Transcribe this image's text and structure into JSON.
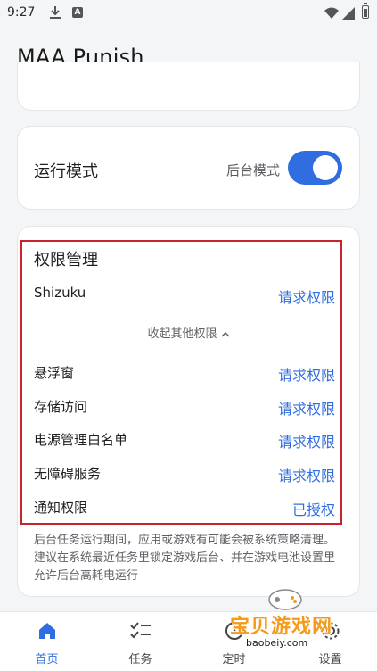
{
  "status": {
    "time": "9:27",
    "a_badge": "A"
  },
  "app": {
    "title": "MAA Punish"
  },
  "mode": {
    "label": "运行模式",
    "value": "后台模式",
    "toggle_on": true
  },
  "permissions": {
    "title": "权限管理",
    "shizuku": {
      "label": "Shizuku",
      "action": "请求权限"
    },
    "collapse_label": "收起其他权限",
    "rows": [
      {
        "label": "悬浮窗",
        "action": "请求权限"
      },
      {
        "label": "存储访问",
        "action": "请求权限"
      },
      {
        "label": "电源管理白名单",
        "action": "请求权限"
      },
      {
        "label": "无障碍服务",
        "action": "请求权限"
      },
      {
        "label": "通知权限",
        "action": "已授权"
      }
    ],
    "note": "后台任务运行期间，应用或游戏有可能会被系统策略清理。建议在系统最近任务里锁定游戏后台、并在游戏电池设置里允许后台高耗电运行"
  },
  "nav": {
    "items": [
      {
        "label": "首页",
        "icon": "home-icon",
        "active": true
      },
      {
        "label": "任务",
        "icon": "checklist-icon",
        "active": false
      },
      {
        "label": "定时",
        "icon": "clock-icon",
        "active": false
      },
      {
        "label": "设置",
        "icon": "gear-icon",
        "active": false
      }
    ]
  },
  "watermark": {
    "text": "宝贝游戏网",
    "sub": "baobeiy.com"
  },
  "colors": {
    "accent": "#2f6de0",
    "highlight_frame": "#c8232b",
    "watermark": "#f59a1b"
  }
}
